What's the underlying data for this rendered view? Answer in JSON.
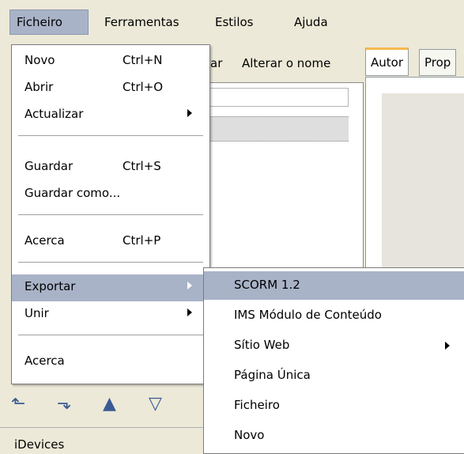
{
  "menubar": {
    "items": [
      {
        "label": "Ficheiro"
      },
      {
        "label": "Ferramentas"
      },
      {
        "label": "Estilos"
      },
      {
        "label": "Ajuda"
      }
    ]
  },
  "background": {
    "toolbar_partial": "ar",
    "rename_button": "Alterar o nome",
    "tabs": [
      "Autor",
      "Prop"
    ],
    "idevices_title": "iDevices"
  },
  "file_menu": {
    "items": [
      {
        "label": "Novo",
        "accel": "Ctrl+N"
      },
      {
        "label": "Abrir",
        "accel": "Ctrl+O"
      },
      {
        "label": "Actualizar"
      },
      {
        "label": "Guardar",
        "accel": "Ctrl+S"
      },
      {
        "label": "Guardar como..."
      },
      {
        "label": "Acerca",
        "accel": "Ctrl+P"
      },
      {
        "label": "Exportar"
      },
      {
        "label": "Unir"
      },
      {
        "label": "Acerca"
      }
    ]
  },
  "export_submenu": {
    "items": [
      {
        "label": "SCORM 1.2"
      },
      {
        "label": "IMS Módulo de Conteúdo"
      },
      {
        "label": "Sítio Web"
      },
      {
        "label": "Página Única"
      },
      {
        "label": "Ficheiro"
      },
      {
        "label": "Novo"
      }
    ]
  },
  "colors": {
    "highlight": "#a9b3c8",
    "window_bg": "#ece9d8",
    "tab_accent": "#f5b84e"
  }
}
